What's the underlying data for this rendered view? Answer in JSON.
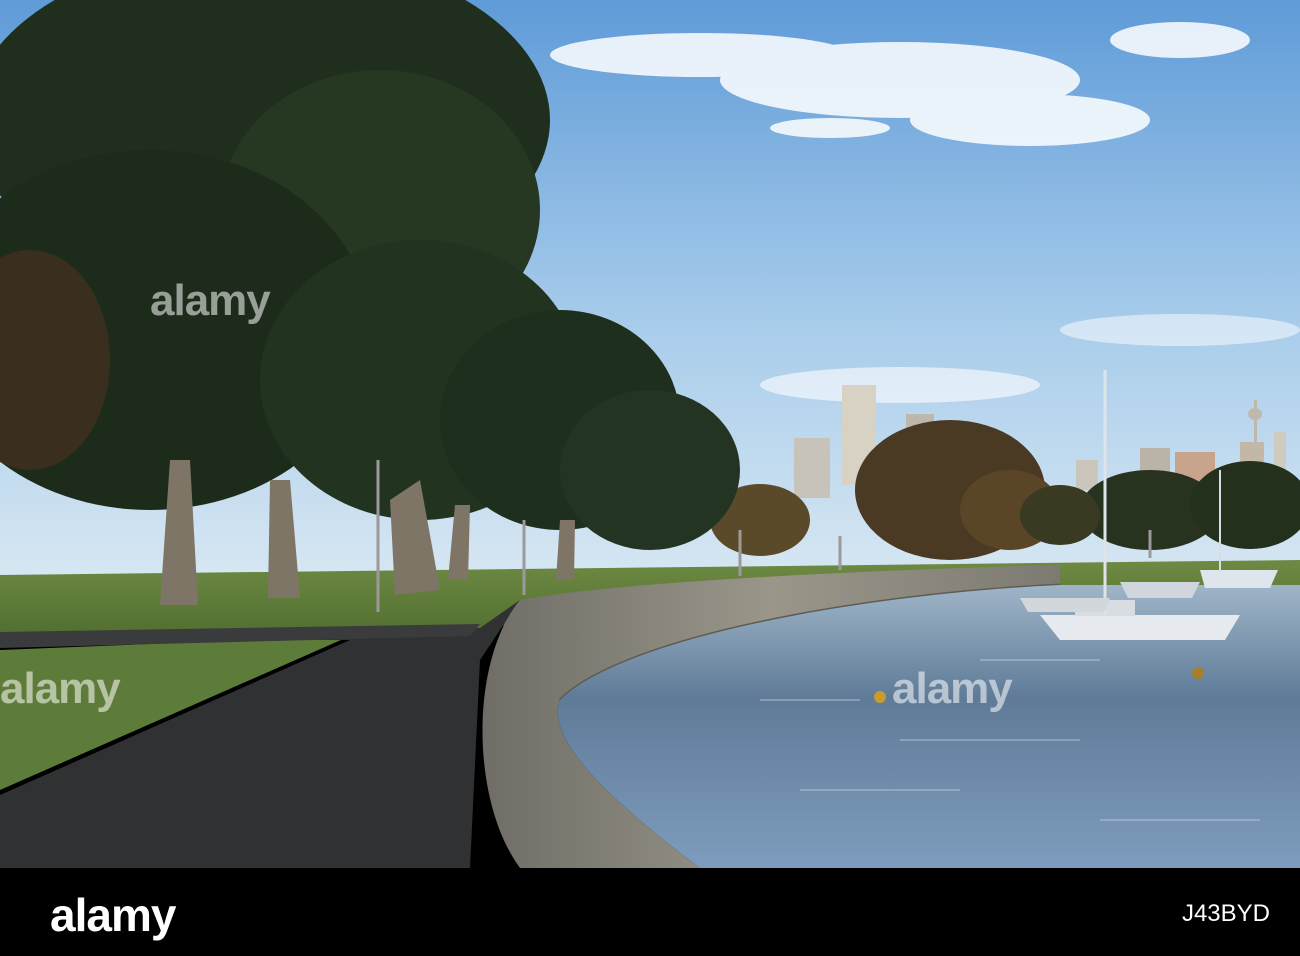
{
  "watermark": {
    "text": "alamy"
  },
  "footer": {
    "logo": "alamy",
    "image_id": "J43BYD"
  },
  "colors": {
    "sky_top": "#6fa6dc",
    "sky_bottom": "#c9e0f2",
    "foliage": "#1f2e1c",
    "grass": "#5f7d3a",
    "path": "#2f3032",
    "seawall": "#8d8a80",
    "water": "#5c7896",
    "footer_bg": "#000000"
  }
}
